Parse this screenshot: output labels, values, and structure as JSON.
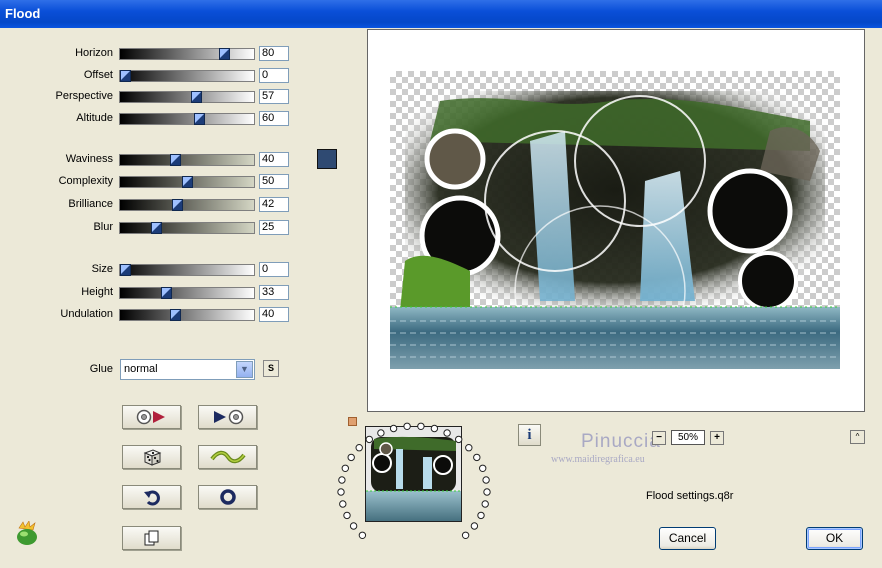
{
  "window": {
    "title": "Flood"
  },
  "params": [
    {
      "key": "horizon",
      "label": "Horizon",
      "value": "80",
      "fraction": 0.8,
      "track": "gray"
    },
    {
      "key": "offset",
      "label": "Offset",
      "value": "0",
      "fraction": 0.0,
      "track": "gray"
    },
    {
      "key": "perspective",
      "label": "Perspective",
      "value": "57",
      "fraction": 0.57,
      "track": "gray"
    },
    {
      "key": "altitude",
      "label": "Altitude",
      "value": "60",
      "fraction": 0.6,
      "track": "gray"
    },
    {
      "key": "waviness",
      "label": "Waviness",
      "value": "40",
      "fraction": 0.4,
      "track": "olive"
    },
    {
      "key": "complexity",
      "label": "Complexity",
      "value": "50",
      "fraction": 0.5,
      "track": "olive"
    },
    {
      "key": "brilliance",
      "label": "Brilliance",
      "value": "42",
      "fraction": 0.42,
      "track": "olive"
    },
    {
      "key": "blur",
      "label": "Blur",
      "value": "25",
      "fraction": 0.25,
      "track": "olive"
    },
    {
      "key": "size",
      "label": "Size",
      "value": "0",
      "fraction": 0.0,
      "track": "gray"
    },
    {
      "key": "height",
      "label": "Height",
      "value": "33",
      "fraction": 0.33,
      "track": "gray"
    },
    {
      "key": "undulation",
      "label": "Undulation",
      "value": "40",
      "fraction": 0.4,
      "track": "gray"
    }
  ],
  "color_swatch": "#2f4a72",
  "glue": {
    "label": "Glue",
    "value": "normal",
    "s_button": "S"
  },
  "tool_buttons": [
    {
      "name": "reel-play-left-button",
      "icon": "film-reel-arrow-icon"
    },
    {
      "name": "play-reel-right-button",
      "icon": "arrow-film-reel-icon"
    },
    {
      "name": "randomize-button",
      "icon": "dice-icon"
    },
    {
      "name": "wave-button",
      "icon": "wave-icon"
    },
    {
      "name": "undo-button",
      "icon": "undo-arrow-icon"
    },
    {
      "name": "reset-button",
      "icon": "ring-icon"
    },
    {
      "name": "copy-button",
      "icon": "copy-icon"
    }
  ],
  "zoom": {
    "value": "50%",
    "minus": "−",
    "plus": "+",
    "caret": "^"
  },
  "watermark": {
    "line1": "Pinuccia",
    "line2": "www.maidiregrafica.eu"
  },
  "settings_file": "Flood settings.q8r",
  "buttons": {
    "cancel": "Cancel",
    "ok": "OK"
  },
  "colors": {
    "titlebar": "#0a4fd8",
    "dialog_bg": "#ece9d8",
    "knob": "#1c3c78"
  }
}
